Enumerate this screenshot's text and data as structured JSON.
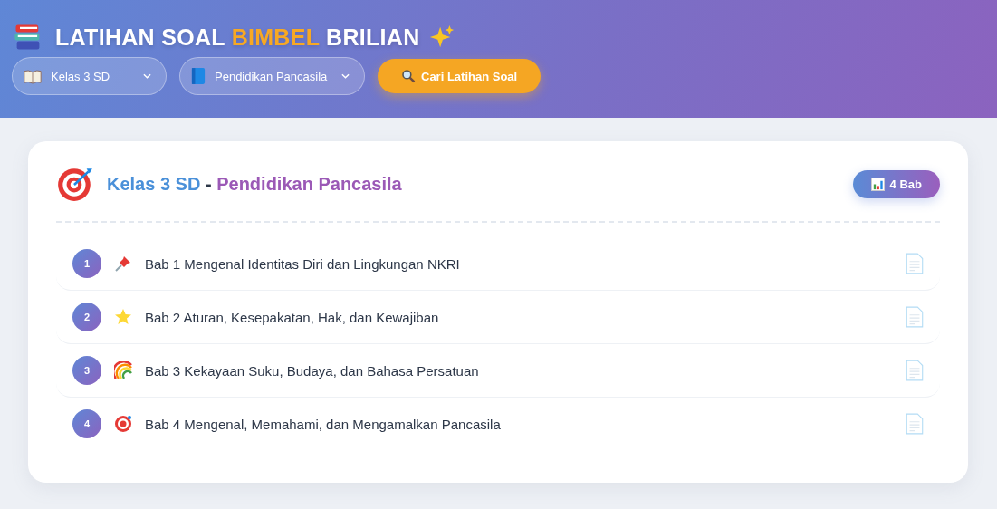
{
  "header": {
    "title_parts": [
      {
        "text": "LATIHAN SOAL",
        "highlight": false
      },
      {
        "text": "BIMBEL",
        "highlight": true
      },
      {
        "text": "BRILIAN",
        "highlight": false
      }
    ],
    "class_select": {
      "value": "Kelas 3 SD"
    },
    "subject_select": {
      "value": "Pendidikan Pancasila"
    },
    "search_button": "Cari Latihan Soal"
  },
  "card": {
    "heading_parts": [
      {
        "text": "Kelas 3 SD",
        "kind": "class"
      },
      {
        "text": "-",
        "kind": "separator"
      },
      {
        "text": "Pendidikan Pancasila",
        "kind": "subject"
      }
    ],
    "count_badge": "4 Bab",
    "chapters": [
      {
        "number": "1",
        "title": "Bab 1 Mengenal Identitas Diri dan Lingkungan NKRI"
      },
      {
        "number": "2",
        "title": "Bab 2 Aturan, Kesepakatan, Hak, dan Kewajiban"
      },
      {
        "number": "3",
        "title": "Bab 3 Kekayaan Suku, Budaya, dan Bahasa Persatuan"
      },
      {
        "number": "4",
        "title": "Bab 4 Mengenal, Memahami, dan Mengamalkan Pancasila"
      }
    ]
  }
}
